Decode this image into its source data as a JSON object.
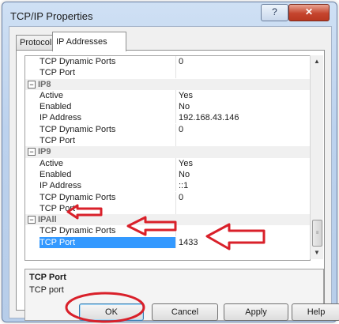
{
  "window": {
    "title": "TCP/IP Properties",
    "help_glyph": "?",
    "close_glyph": "✕"
  },
  "tabs": [
    {
      "label": "Protocol"
    },
    {
      "label": "IP Addresses"
    }
  ],
  "rows": [
    {
      "type": "prop",
      "name": "TCP Dynamic Ports",
      "value": "0"
    },
    {
      "type": "prop",
      "name": "TCP Port",
      "value": ""
    },
    {
      "type": "group",
      "name": "IP8",
      "expander": "−"
    },
    {
      "type": "prop",
      "name": "Active",
      "value": "Yes"
    },
    {
      "type": "prop",
      "name": "Enabled",
      "value": "No"
    },
    {
      "type": "prop",
      "name": "IP Address",
      "value": "192.168.43.146"
    },
    {
      "type": "prop",
      "name": "TCP Dynamic Ports",
      "value": "0"
    },
    {
      "type": "prop",
      "name": "TCP Port",
      "value": ""
    },
    {
      "type": "group",
      "name": "IP9",
      "expander": "−"
    },
    {
      "type": "prop",
      "name": "Active",
      "value": "Yes"
    },
    {
      "type": "prop",
      "name": "Enabled",
      "value": "No"
    },
    {
      "type": "prop",
      "name": "IP Address",
      "value": "::1"
    },
    {
      "type": "prop",
      "name": "TCP Dynamic Ports",
      "value": "0"
    },
    {
      "type": "prop",
      "name": "TCP Port",
      "value": ""
    },
    {
      "type": "group",
      "name": "IPAll",
      "expander": "−"
    },
    {
      "type": "prop",
      "name": "TCP Dynamic Ports",
      "value": ""
    },
    {
      "type": "prop",
      "name": "TCP Port",
      "value": "1433",
      "selected": true
    }
  ],
  "scrollbar": {
    "up": "▲",
    "down": "▼",
    "thumb_grip": "≡"
  },
  "description": {
    "title": "TCP Port",
    "text": "TCP port"
  },
  "buttons": {
    "ok": "OK",
    "cancel": "Cancel",
    "apply": "Apply",
    "help": "Help"
  },
  "colors": {
    "selection": "#3399ff",
    "annotation": "#d9202a"
  }
}
